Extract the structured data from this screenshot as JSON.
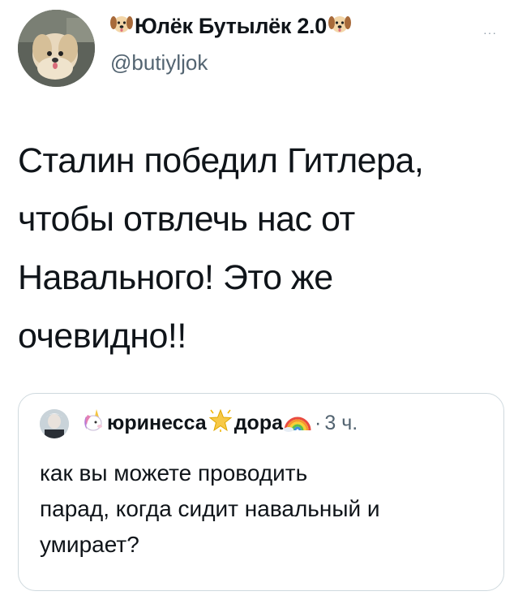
{
  "author": {
    "name": "Юлёк Бутылёк 2.0",
    "name_emoji": "dog-face-icon",
    "handle": "@butiyljok"
  },
  "more_label": "···",
  "tweet": {
    "lines": [
      "Сталин победил Гитлера,",
      "чтобы отвлечь нас от",
      "Навального! Это же",
      "очевидно!!"
    ]
  },
  "quote": {
    "name_part1": "юринесса",
    "name_part2": "дора",
    "separator": "·",
    "time": "3 ч.",
    "icons": [
      "unicorn-icon",
      "glowing-star-icon",
      "rainbow-icon"
    ],
    "lines": [
      "как вы можете проводить",
      "парад, когда сидит навальный и",
      "умирает?"
    ]
  }
}
